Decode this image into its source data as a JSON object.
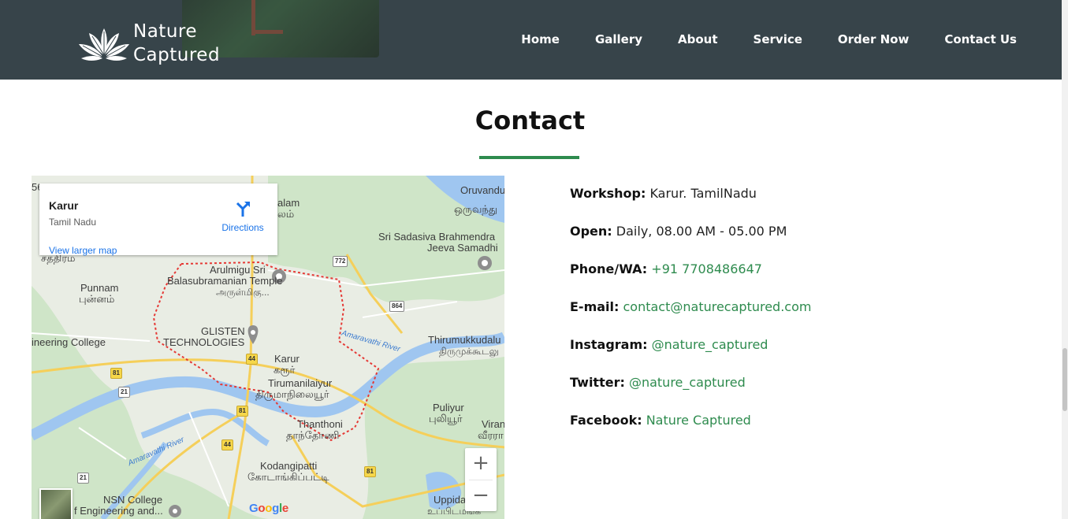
{
  "brand": {
    "line1": "Nature",
    "line2": "Captured"
  },
  "nav": {
    "items": [
      {
        "label": "Home"
      },
      {
        "label": "Gallery"
      },
      {
        "label": "About"
      },
      {
        "label": "Service"
      },
      {
        "label": "Order Now"
      },
      {
        "label": "Contact Us"
      }
    ]
  },
  "section": {
    "title": "Contact",
    "accent_color": "#2e8b4e"
  },
  "map": {
    "card": {
      "name": "Karur",
      "region": "Tamil Nadu",
      "directions_label": "Directions",
      "larger_map_label": "View larger map"
    },
    "zoom_in": "+",
    "zoom_out": "−",
    "attribution": "Google",
    "labels": {
      "oruvandu": "Oruvandu",
      "oruvandu_ta": "ஒருவந்து",
      "alam": "alam",
      "alam_ta": "லம்",
      "sathram": "சத்திரம்",
      "brahmendra_1": "Sri Sadasiva Brahmendra",
      "brahmendra_2": "Jeeva Samadhi",
      "arulmigu_1": "Arulmigu Sri",
      "arulmigu_2": "Balasubramanian Temple",
      "arulmigu_ta": "அருள்மிகு...",
      "punnam": "Punnam",
      "punnam_ta": "புன்னம்",
      "glisten_1": "GLISTEN",
      "glisten_2": "TECHNOLOGIES",
      "college": "ineering College",
      "karur": "Karur",
      "karur_ta": "கரூர்",
      "tirumanilaiyur": "Tirumanilaiyur",
      "tirumanilaiyur_ta": "திருமாநிலையூர்",
      "amaravathi_river_1": "Amaravathi River",
      "amaravathi_river_2": "Amaravathi River",
      "thirumukkudalu": "Thirumukkudalu",
      "thirumukkudalu_ta": "திருமுக்கூடலு",
      "puliyur": "Puliyur",
      "puliyur_ta": "புலியூர்",
      "viran": "Viran",
      "viran_ta": "வீரரா",
      "thanthoni": "Thanthoni",
      "thanthoni_ta": "தாந்தோணி",
      "kodangipatti": "Kodangipatti",
      "kodangipatti_ta": "கோடாங்கிப்பட்டி",
      "nsn_1": "NSN College",
      "nsn_2": "f Engineering and...",
      "uppida": "Uppida",
      "uppida_ta": "உப்பிடமங்க",
      "num_56": "56"
    },
    "shields": {
      "r772": "772",
      "r864": "864",
      "r44a": "44",
      "r44b": "44",
      "r81a": "81",
      "r81b": "81",
      "r81c": "81",
      "r21a": "21",
      "r21b": "21"
    }
  },
  "contact": {
    "workshop": {
      "label": "Workshop:",
      "value": "Karur. TamilNadu"
    },
    "open": {
      "label": "Open:",
      "value": "Daily, 08.00 AM - 05.00 PM"
    },
    "phone": {
      "label": "Phone/WA:",
      "value": "+91 7708486647"
    },
    "email": {
      "label": "E-mail:",
      "value": "contact@naturecaptured.com"
    },
    "instagram": {
      "label": "Instagram:",
      "value": "@nature_captured"
    },
    "twitter": {
      "label": "Twitter:",
      "value": "@nature_captured"
    },
    "facebook": {
      "label": "Facebook:",
      "value": "Nature Captured"
    }
  }
}
